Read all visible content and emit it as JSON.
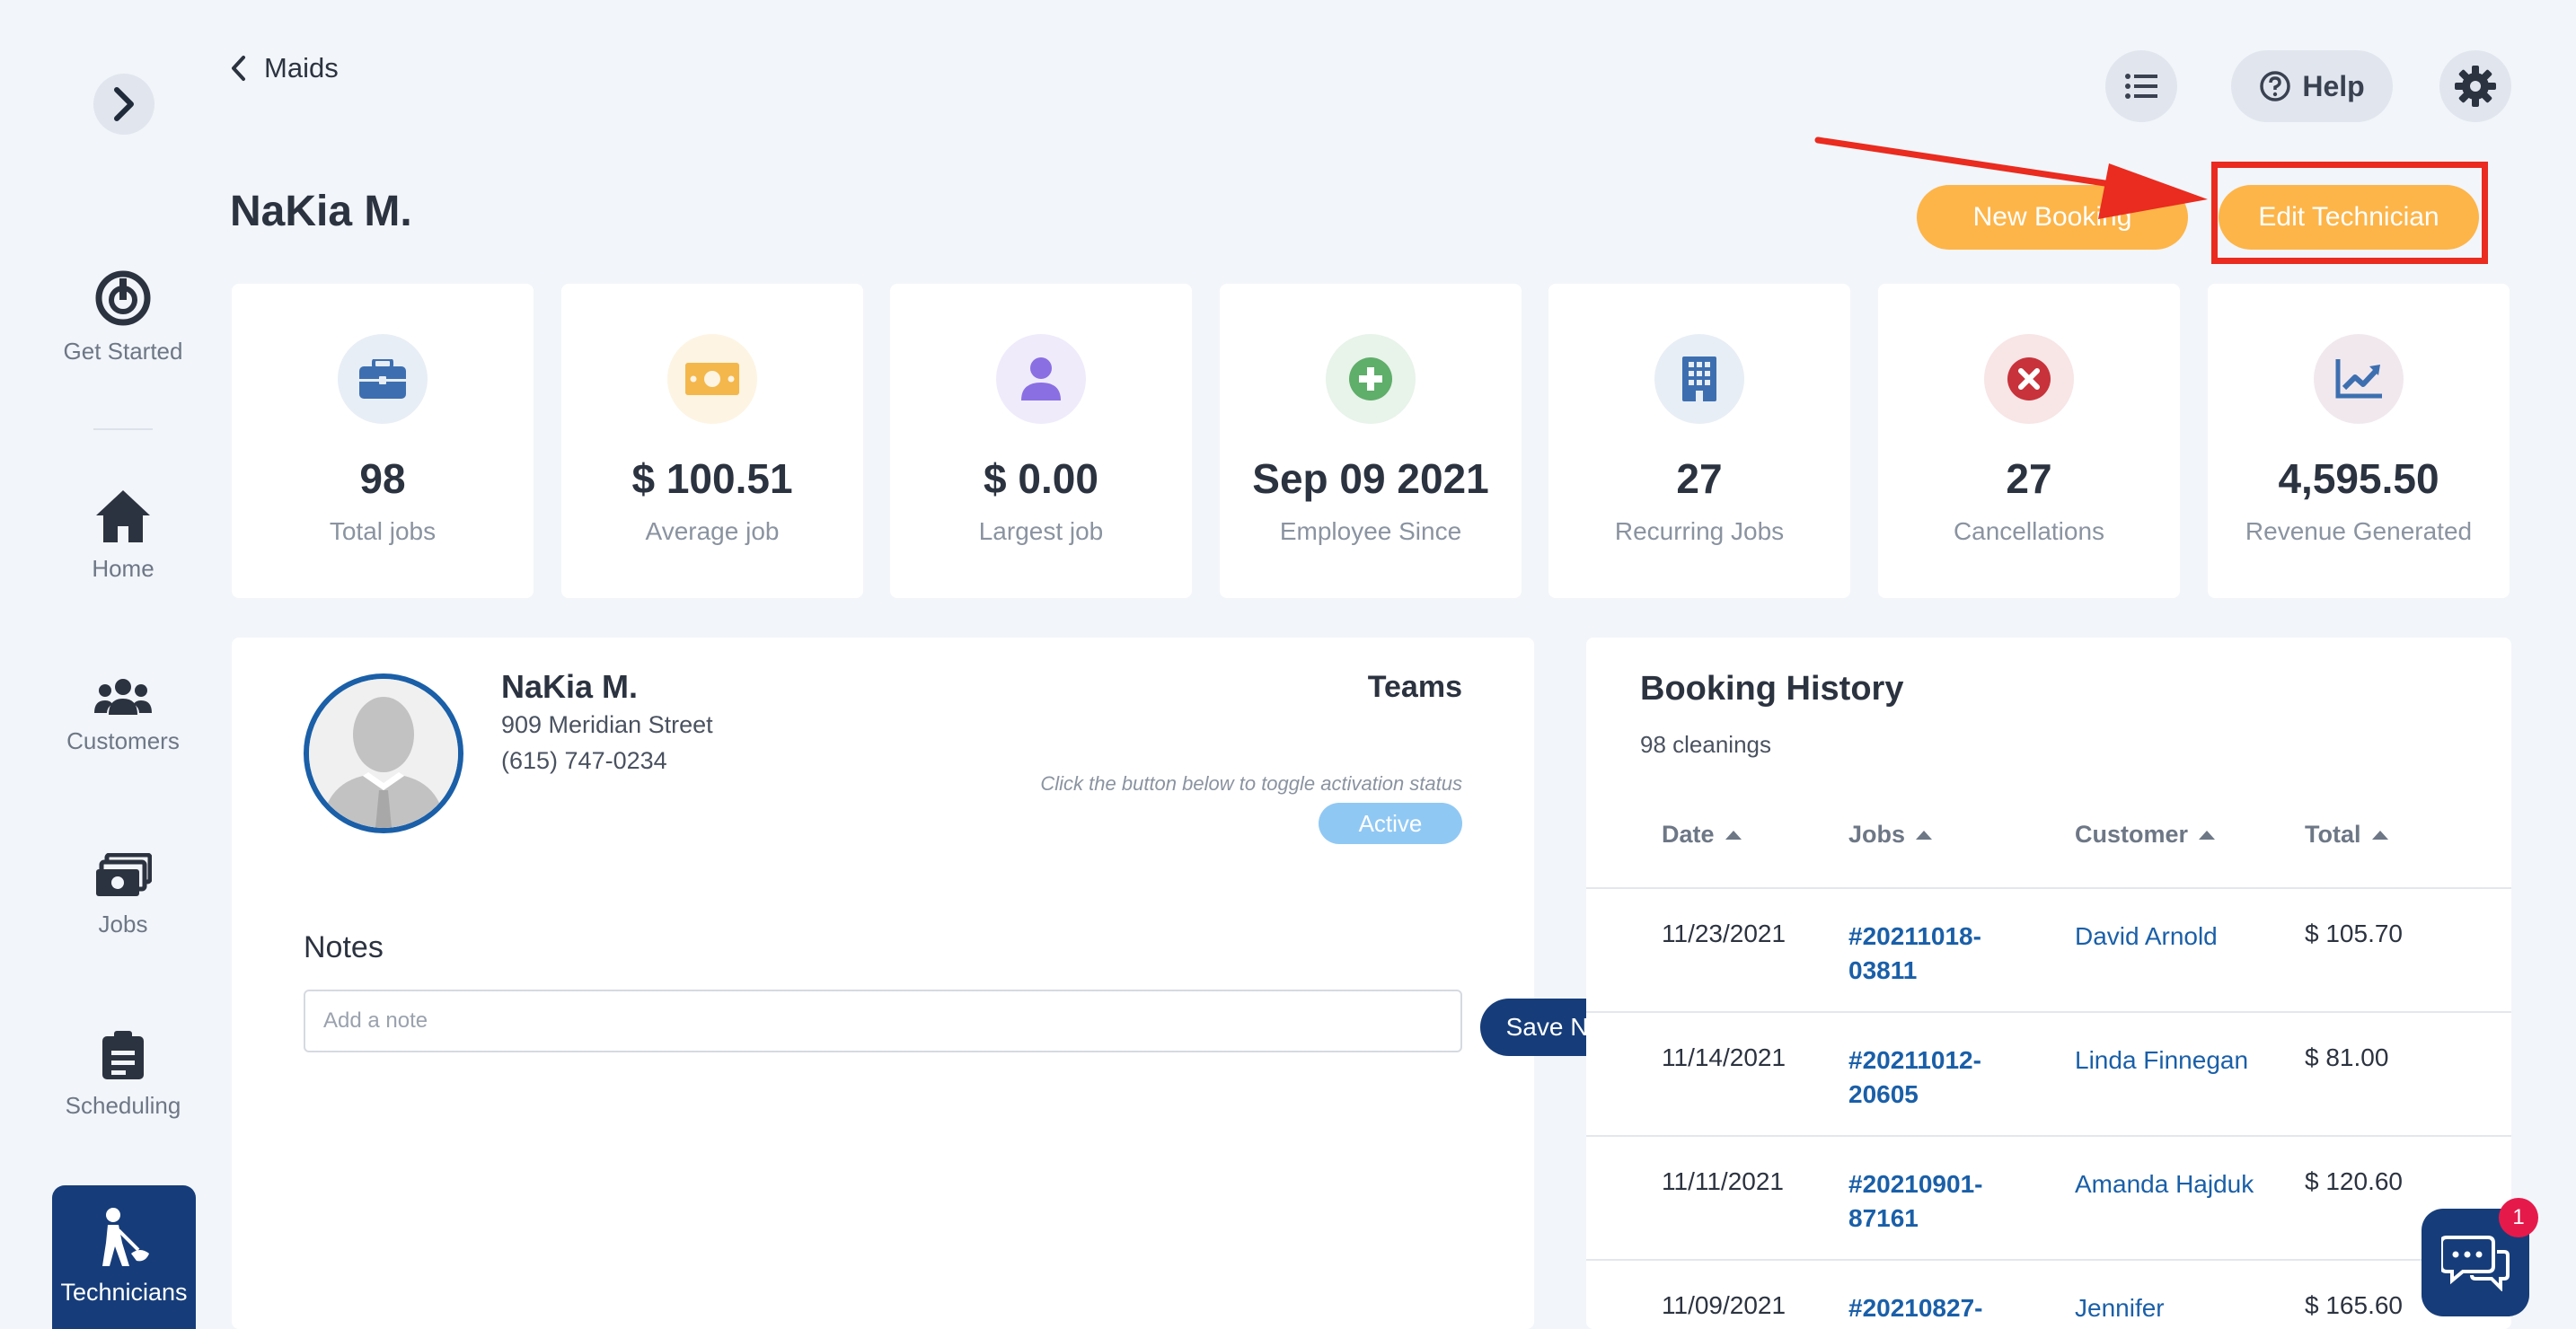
{
  "sidebar": {
    "items": [
      {
        "label": "Get Started",
        "icon": "power-icon"
      },
      {
        "label": "Home",
        "icon": "home-icon"
      },
      {
        "label": "Customers",
        "icon": "users-icon"
      },
      {
        "label": "Jobs",
        "icon": "money-icon"
      },
      {
        "label": "Scheduling",
        "icon": "clipboard-icon"
      },
      {
        "label": "Technicians",
        "icon": "technician-icon",
        "active": true
      }
    ]
  },
  "header": {
    "breadcrumb": "Maids",
    "help_label": "Help"
  },
  "page": {
    "title": "NaKia M.",
    "new_booking_label": "New Booking",
    "edit_technician_label": "Edit Technician"
  },
  "stats": [
    {
      "value": "98",
      "label": "Total jobs",
      "icon": "briefcase-icon",
      "color": "#3d6fb0",
      "bg": "#e8eef6"
    },
    {
      "value": "$ 100.51",
      "label": "Average job",
      "icon": "cash-icon",
      "color": "#f3b74b",
      "bg": "#fdf4e3"
    },
    {
      "value": "$ 0.00",
      "label": "Largest job",
      "icon": "user-icon",
      "color": "#8a6fe3",
      "bg": "#efebfb"
    },
    {
      "value": "Sep 09 2021",
      "label": "Employee Since",
      "icon": "plus-circle-icon",
      "color": "#5fae6a",
      "bg": "#e8f3ea"
    },
    {
      "value": "27",
      "label": "Recurring Jobs",
      "icon": "building-icon",
      "color": "#3d6fb0",
      "bg": "#e8eef6"
    },
    {
      "value": "27",
      "label": "Cancellations",
      "icon": "x-circle-icon",
      "color": "#c8323a",
      "bg": "#f8e5e6"
    },
    {
      "value": "4,595.50",
      "label": "Revenue Generated",
      "icon": "chart-line-icon",
      "color": "#3d6fb0",
      "bg": "#f1e8ee"
    }
  ],
  "profile": {
    "name": "NaKia M.",
    "address": "909 Meridian Street",
    "phone": "(615) 747-0234",
    "teams_label": "Teams",
    "toggle_hint": "Click the button below to toggle activation status",
    "status": "Active",
    "notes_label": "Notes",
    "note_placeholder": "Add a note",
    "save_note_label": "Save Note"
  },
  "history": {
    "title": "Booking History",
    "subtitle": "98 cleanings",
    "columns": [
      "Date",
      "Jobs",
      "Customer",
      "Total"
    ],
    "rows": [
      {
        "date": "11/23/2021",
        "job": "#20211018-03811",
        "customer": "David Arnold",
        "total": "$ 105.70"
      },
      {
        "date": "11/14/2021",
        "job": "#20211012-20605",
        "customer": "Linda Finnegan",
        "total": "$ 81.00"
      },
      {
        "date": "11/11/2021",
        "job": "#20210901-87161",
        "customer": "Amanda Hajduk",
        "total": "$ 120.60"
      },
      {
        "date": "11/09/2021",
        "job": "#20210827-",
        "customer": "Jennifer",
        "total": "$ 165.60"
      }
    ]
  },
  "chat": {
    "badge": "1"
  }
}
